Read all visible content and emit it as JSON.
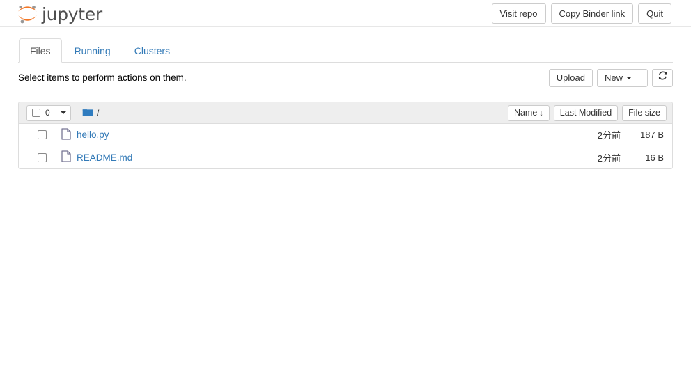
{
  "header": {
    "brand": "jupyter",
    "logo_icon": "jupyter-logo",
    "buttons": [
      {
        "label": "Visit repo",
        "name": "visit-repo-button"
      },
      {
        "label": "Copy Binder link",
        "name": "copy-binder-link-button"
      },
      {
        "label": "Quit",
        "name": "quit-button"
      }
    ]
  },
  "tabs": [
    {
      "label": "Files",
      "active": true
    },
    {
      "label": "Running",
      "active": false
    },
    {
      "label": "Clusters",
      "active": false
    }
  ],
  "toolbar": {
    "select_hint": "Select items to perform actions on them.",
    "upload_label": "Upload",
    "new_label": "New",
    "refresh_icon": "refresh-icon"
  },
  "list_header": {
    "select_count": "0",
    "folder_icon": "folder-icon",
    "breadcrumb_root": "/",
    "sort": {
      "name_label": "Name",
      "name_arrow": "↓",
      "last_modified_label": "Last Modified",
      "file_size_label": "File size"
    }
  },
  "files": [
    {
      "name": "hello.py",
      "icon": "file-icon",
      "modified": "2分前",
      "size": "187 B"
    },
    {
      "name": "README.md",
      "icon": "file-icon",
      "modified": "2分前",
      "size": "16 B"
    }
  ],
  "colors": {
    "link": "#337ab7",
    "logo_orange": "#f37726",
    "logo_gray": "#989898",
    "folder_blue": "#2f7cbf",
    "header_bg": "#eeeeee",
    "border": "#dddddd"
  }
}
